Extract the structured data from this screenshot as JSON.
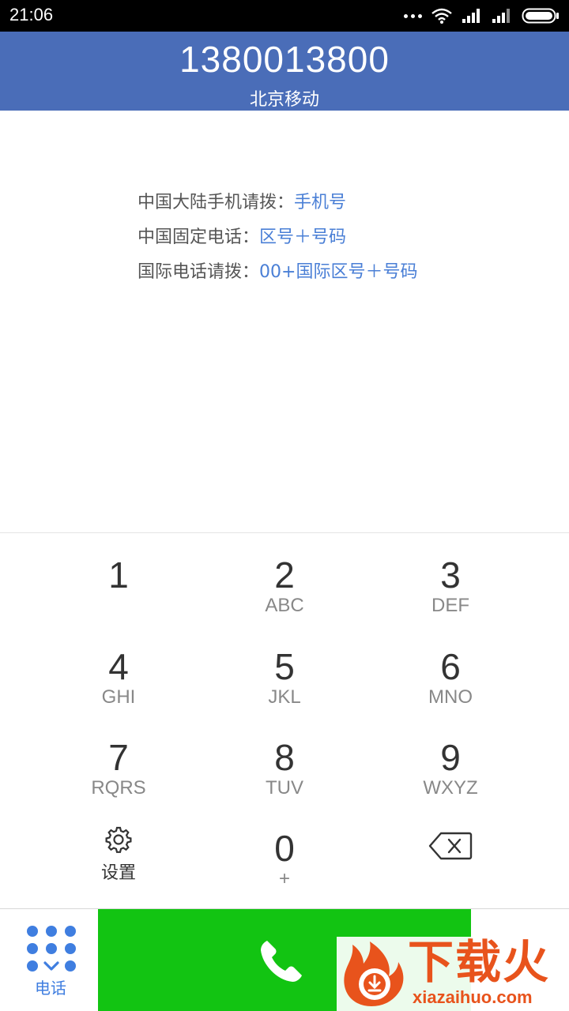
{
  "status_bar": {
    "time": "21:06",
    "icons": [
      "more-dots-icon",
      "wifi-icon",
      "signal-icon",
      "signal-icon-2",
      "battery-icon"
    ]
  },
  "header": {
    "number": "1380013800",
    "carrier": "北京移动"
  },
  "hints": [
    {
      "label": "中国大陆手机请拨：",
      "value": "手机号"
    },
    {
      "label": "中国固定电话：",
      "value": "区号＋号码"
    },
    {
      "label": "国际电话请拨：",
      "value": "00+国际区号＋号码"
    }
  ],
  "keypad": [
    {
      "digit": "1",
      "letters": ""
    },
    {
      "digit": "2",
      "letters": "ABC"
    },
    {
      "digit": "3",
      "letters": "DEF"
    },
    {
      "digit": "4",
      "letters": "GHI"
    },
    {
      "digit": "5",
      "letters": "JKL"
    },
    {
      "digit": "6",
      "letters": "MNO"
    },
    {
      "digit": "7",
      "letters": "RQRS"
    },
    {
      "digit": "8",
      "letters": "TUV"
    },
    {
      "digit": "9",
      "letters": "WXYZ"
    },
    {
      "digit": "0",
      "letters": "+"
    }
  ],
  "settings": {
    "label": "设置",
    "icon": "gear-icon"
  },
  "backspace": {
    "icon": "backspace-icon"
  },
  "bottom": {
    "tab_label": "电话",
    "call_icon": "phone-icon"
  },
  "watermark": {
    "title": "下载火",
    "url": "xiazaihuo.com"
  },
  "colors": {
    "header_bg": "#4a6db8",
    "call_button": "#12c412",
    "accent_blue": "#4a7fd6",
    "watermark": "#e8531c"
  }
}
